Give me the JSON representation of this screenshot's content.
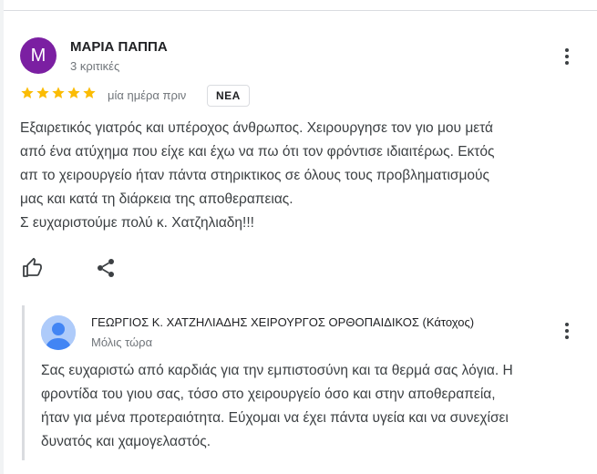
{
  "review": {
    "avatar_letter": "M",
    "avatar_color": "#7b1fa2",
    "author": "ΜΑΡΙΑ ΠΑΠΠΑ",
    "author_meta": "3 κριτικές",
    "rating": 5,
    "rating_max": 5,
    "star_color": "#fbbc04",
    "time": "μία ημέρα πριν",
    "badge": "ΝΕΑ",
    "text_lines": [
      "Εξαιρετικός γιατρός και υπέροχος άνθρωπος. Χειρουργησε τον γιο μου μετά",
      "από ένα ατύχημα που είχε και έχω να πω ότι τον φρόντισε ιδιαιτέρως. Εκτός",
      "απ το χειρουργείο ήταν πάντα στηρικτικος σε όλους τους προβληματισμούς",
      "μας και κατά τη διάρκεια της αποθεραπειας.",
      "Σ ευχαριστούμε πολύ κ. Χατζηλιαδη!!!"
    ],
    "actions": {
      "like_icon": "thumb-up-icon",
      "share_icon": "share-icon",
      "more_icon": "more-vert-icon"
    }
  },
  "reply": {
    "owner_name": "ΓΕΩΡΓΙΟΣ Κ. ΧΑΤΖΗΛΙΑΔΗΣ ΧΕΙΡΟΥΡΓΟΣ ΟΡΘΟΠΑΙΔΙΚΟΣ (Κάτοχος)",
    "time": "Μόλις τώρα",
    "avatar_icon": "default-profile-icon",
    "avatar_color": "#aecbfa",
    "text_lines": [
      "Σας ευχαριστώ από καρδιάς για την εμπιστοσύνη και τα θερμά σας λόγια. Η",
      "φροντίδα του γιου σας, τόσο στο χειρουργείο όσο και στην αποθεραπεία,",
      "ήταν για μένα προτεραιότητα. Εύχομαι να έχει πάντα υγεία και να συνεχίσει",
      "δυνατός και χαμογελαστός."
    ]
  }
}
